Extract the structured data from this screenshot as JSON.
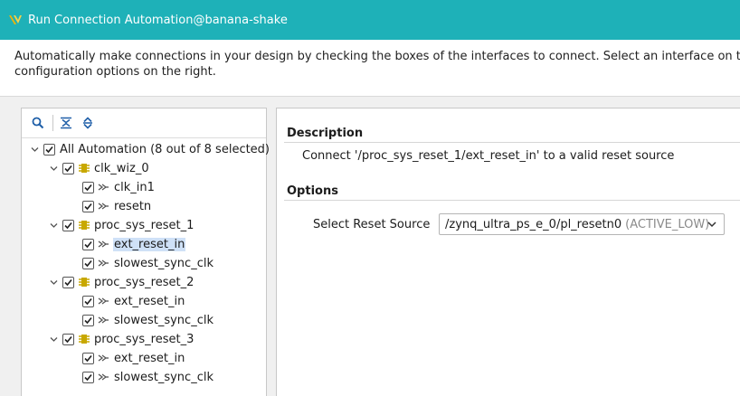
{
  "window": {
    "title": "Run Connection Automation@banana-shake",
    "colors": {
      "titlebar": "#1eb1b8",
      "selection": "#cfe1f7",
      "port_icon": "#c8a800"
    }
  },
  "banner": {
    "line1": "Automatically make connections in your design by checking the boxes of the interfaces to connect. Select an interface on the le",
    "line2": "configuration options on the right."
  },
  "toolbar": {
    "icons": [
      "search-icon",
      "collapse-all-icon",
      "expand-all-icon"
    ]
  },
  "tree": {
    "root": {
      "label": "All Automation (8 out of 8 selected)",
      "checked": true
    },
    "groups": [
      {
        "label": "clk_wiz_0",
        "checked": true,
        "children": [
          {
            "label": "clk_in1",
            "checked": true
          },
          {
            "label": "resetn",
            "checked": true
          }
        ]
      },
      {
        "label": "proc_sys_reset_1",
        "checked": true,
        "children": [
          {
            "label": "ext_reset_in",
            "checked": true,
            "selected": true
          },
          {
            "label": "slowest_sync_clk",
            "checked": true
          }
        ]
      },
      {
        "label": "proc_sys_reset_2",
        "checked": true,
        "children": [
          {
            "label": "ext_reset_in",
            "checked": true
          },
          {
            "label": "slowest_sync_clk",
            "checked": true
          }
        ]
      },
      {
        "label": "proc_sys_reset_3",
        "checked": true,
        "children": [
          {
            "label": "ext_reset_in",
            "checked": true
          },
          {
            "label": "slowest_sync_clk",
            "checked": true
          }
        ]
      }
    ]
  },
  "details": {
    "description_heading": "Description",
    "description_text": "Connect '/proc_sys_reset_1/ext_reset_in' to a valid reset source",
    "options_heading": "Options",
    "reset_source_label": "Select Reset Source",
    "reset_source_value": "/zynq_ultra_ps_e_0/pl_resetn0",
    "reset_source_hint": "(ACTIVE_LOW)"
  }
}
